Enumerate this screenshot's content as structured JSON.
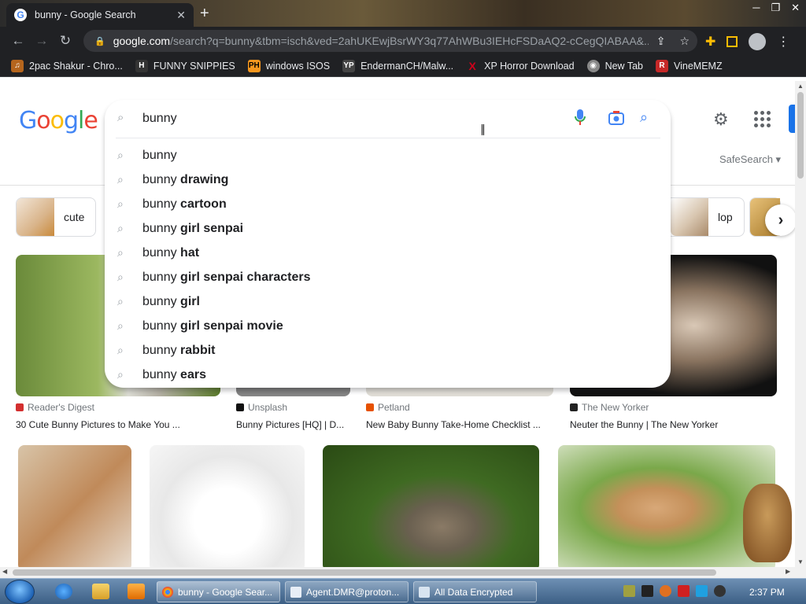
{
  "browser": {
    "tab_title": "bunny - Google Search",
    "new_tab": "+",
    "url_host": "google.com",
    "url_path": "/search?q=bunny&tbm=isch&ved=2ahUKEwjBsrWY3q77AhWBu3IEHcFSDaAQ2-cCegQIABAA&..."
  },
  "bookmarks": [
    {
      "label": "2pac Shakur - Chro...",
      "icon": "2pac-icon",
      "color": "#b5651d"
    },
    {
      "label": "FUNNY SNIPPIES",
      "icon": "H",
      "color": "#333333"
    },
    {
      "label": "windows ISOS",
      "icon": "PH",
      "color": "#f7971e"
    },
    {
      "label": "EndermanCH/Malw...",
      "icon": "YP",
      "color": "#444444"
    },
    {
      "label": "XP Horror Download",
      "icon": "X",
      "color": "#d0021b"
    },
    {
      "label": "New Tab",
      "icon": "newtab-icon",
      "color": "#888888"
    },
    {
      "label": "VineMEMZ",
      "icon": "R",
      "color": "#c62828"
    }
  ],
  "search": {
    "query": "bunny",
    "safesearch": "SafeSearch",
    "suggestions": [
      {
        "base": "bunny",
        "extra": ""
      },
      {
        "base": "bunny",
        "extra": "drawing"
      },
      {
        "base": "bunny",
        "extra": "cartoon"
      },
      {
        "base": "bunny",
        "extra": "girl senpai"
      },
      {
        "base": "bunny",
        "extra": "hat"
      },
      {
        "base": "bunny",
        "extra": "girl senpai characters"
      },
      {
        "base": "bunny",
        "extra": "girl"
      },
      {
        "base": "bunny",
        "extra": "girl senpai movie"
      },
      {
        "base": "bunny",
        "extra": "rabbit"
      },
      {
        "base": "bunny",
        "extra": "ears"
      }
    ]
  },
  "chips": [
    {
      "label": "cute"
    },
    {
      "label": "lop"
    }
  ],
  "results": [
    {
      "source": "Reader's Digest",
      "title": "30 Cute Bunny Pictures to Make You ...",
      "src_color": "#d32f2f"
    },
    {
      "source": "Unsplash",
      "title": "Bunny Pictures [HQ] | D...",
      "src_color": "#111111"
    },
    {
      "source": "Petland",
      "title": "New Baby Bunny Take-Home Checklist ...",
      "src_color": "#e65100"
    },
    {
      "source": "The New Yorker",
      "title": "Neuter the Bunny | The New Yorker",
      "src_color": "#222222"
    }
  ],
  "taskbar": {
    "items": [
      {
        "label": "bunny - Google Sear..."
      },
      {
        "label": "Agent.DMR@proton..."
      },
      {
        "label": "All Data Encrypted"
      }
    ],
    "clock": "2:37 PM"
  }
}
